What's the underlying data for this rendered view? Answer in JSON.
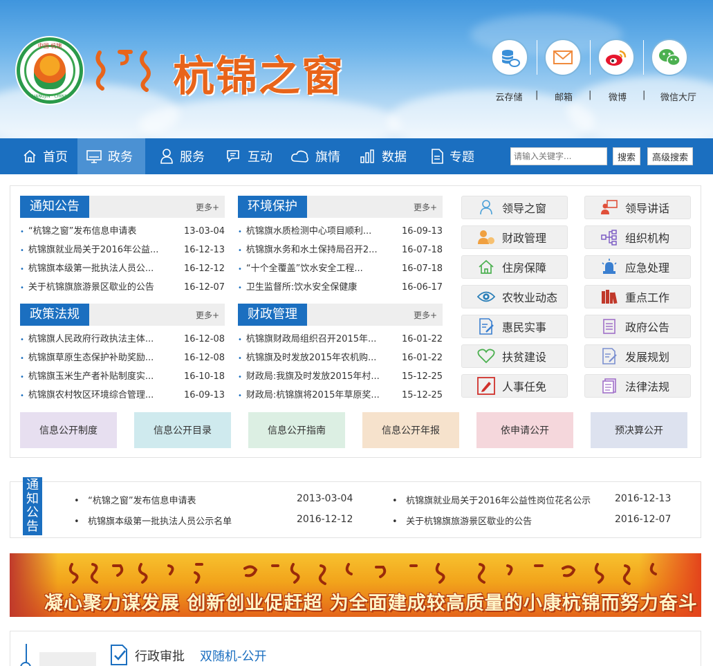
{
  "header": {
    "emblem_top": "中国·杭锦",
    "emblem_bottom": "HANGJIN · CHINA",
    "site_title": "杭锦之窗",
    "top_links": [
      {
        "label": "云存储",
        "icon": "cloud-storage-icon"
      },
      {
        "label": "邮箱",
        "icon": "mail-icon"
      },
      {
        "label": "微博",
        "icon": "weibo-icon"
      },
      {
        "label": "微信大厅",
        "icon": "wechat-icon"
      }
    ],
    "separator": "|"
  },
  "nav": {
    "items": [
      {
        "label": "首页",
        "icon": "home-icon"
      },
      {
        "label": "政务",
        "icon": "monitor-icon"
      },
      {
        "label": "服务",
        "icon": "person-icon"
      },
      {
        "label": "互动",
        "icon": "chat-icon"
      },
      {
        "label": "旗情",
        "icon": "cloud-icon"
      },
      {
        "label": "数据",
        "icon": "bar-chart-icon"
      },
      {
        "label": "专题",
        "icon": "document-icon"
      }
    ],
    "search_placeholder": "请输入关键字...",
    "search_button": "搜索",
    "advanced_search_button": "高级搜索"
  },
  "news": {
    "more": "更多+",
    "blocks": [
      {
        "title": "通知公告",
        "items": [
          {
            "text": "“杭锦之窗”发布信息申请表",
            "date": "13-03-04"
          },
          {
            "text": "杭锦旗就业局关于2016年公益...",
            "date": "16-12-13"
          },
          {
            "text": "杭锦旗本级第一批执法人员公...",
            "date": "16-12-12"
          },
          {
            "text": "关于杭锦旗旅游景区歇业的公告",
            "date": "16-12-07"
          }
        ]
      },
      {
        "title": "环境保护",
        "items": [
          {
            "text": "杭锦旗水质检测中心项目顺利...",
            "date": "16-09-13"
          },
          {
            "text": "杭锦旗水务和水土保持局召开2...",
            "date": "16-07-18"
          },
          {
            "text": "“十个全覆盖”饮水安全工程...",
            "date": "16-07-18"
          },
          {
            "text": "卫生监督所:饮水安全保健康",
            "date": "16-06-17"
          }
        ]
      },
      {
        "title": "政策法规",
        "items": [
          {
            "text": "杭锦旗人民政府行政执法主体...",
            "date": "16-12-08"
          },
          {
            "text": "杭锦旗草原生态保护补助奖励...",
            "date": "16-12-08"
          },
          {
            "text": "杭锦旗玉米生产者补贴制度实...",
            "date": "16-10-18"
          },
          {
            "text": "杭锦旗农村牧区环境综合管理...",
            "date": "16-09-13"
          }
        ]
      },
      {
        "title": "财政管理",
        "items": [
          {
            "text": "杭锦旗财政局组织召开2015年...",
            "date": "16-01-22"
          },
          {
            "text": "杭锦旗及时发放2015年农机购...",
            "date": "16-01-22"
          },
          {
            "text": "财政局:我旗及时发放2015年村...",
            "date": "15-12-25"
          },
          {
            "text": "财政局:杭锦旗将2015年草原奖...",
            "date": "15-12-25"
          }
        ]
      }
    ]
  },
  "quick_links": [
    {
      "label": "领导之窗",
      "icon": "leader-icon",
      "color": "#4aa0d8"
    },
    {
      "label": "领导讲话",
      "icon": "speech-icon",
      "color": "#e0503a"
    },
    {
      "label": "财政管理",
      "icon": "finance-icon",
      "color": "#f0a040"
    },
    {
      "label": "组织机构",
      "icon": "org-chart-icon",
      "color": "#7c5cc4"
    },
    {
      "label": "住房保障",
      "icon": "house-icon",
      "color": "#4cb050"
    },
    {
      "label": "应急处理",
      "icon": "alarm-icon",
      "color": "#3a7fd0"
    },
    {
      "label": "农牧业动态",
      "icon": "eye-icon",
      "color": "#2a7fb8"
    },
    {
      "label": "重点工作",
      "icon": "books-icon",
      "color": "#c0392b"
    },
    {
      "label": "惠民实事",
      "icon": "edit-doc-icon",
      "color": "#3a7fd0"
    },
    {
      "label": "政府公告",
      "icon": "notice-doc-icon",
      "color": "#a070c8"
    },
    {
      "label": "扶贫建设",
      "icon": "heart-icon",
      "color": "#4cb050"
    },
    {
      "label": "发展规划",
      "icon": "plan-doc-icon",
      "color": "#7a8fd0"
    },
    {
      "label": "人事任免",
      "icon": "pencil-icon",
      "color": "#d0302b"
    },
    {
      "label": "法律法规",
      "icon": "law-doc-icon",
      "color": "#a070c8"
    }
  ],
  "public_info": [
    {
      "label": "信息公开制度",
      "color": "#e7dff0"
    },
    {
      "label": "信息公开目录",
      "color": "#cfeaee"
    },
    {
      "label": "信息公开指南",
      "color": "#dcefe3"
    },
    {
      "label": "信息公开年报",
      "color": "#f6e2cc"
    },
    {
      "label": "依申请公开",
      "color": "#f5d7dc"
    },
    {
      "label": "预决算公开",
      "color": "#dde2ef"
    }
  ],
  "notice_bar": {
    "label": [
      "通",
      "知",
      "公",
      "告"
    ],
    "items": [
      {
        "text": "“杭锦之窗”发布信息申请表",
        "date": "2013-03-04"
      },
      {
        "text": "杭锦旗就业局关于2016年公益性岗位花名公示",
        "date": "2016-12-13"
      },
      {
        "text": "杭锦旗本级第一批执法人员公示名单",
        "date": "2016-12-12"
      },
      {
        "text": "关于杭锦旗旅游景区歇业的公告",
        "date": "2016-12-07"
      }
    ]
  },
  "banner": {
    "slogan": "凝心聚力谋发展   创新创业促赶超   为全面建成较高质量的小康杭锦而努力奋斗"
  },
  "bottom": {
    "tabs": [
      {
        "label": "行政审批",
        "color": "#333333"
      },
      {
        "label": "双随机-公开",
        "color": "#1b6fc0"
      }
    ]
  },
  "colors": {
    "primary": "#1b6fc0",
    "nav_active": "#4b91d3",
    "title_orange": "#e8641a"
  }
}
